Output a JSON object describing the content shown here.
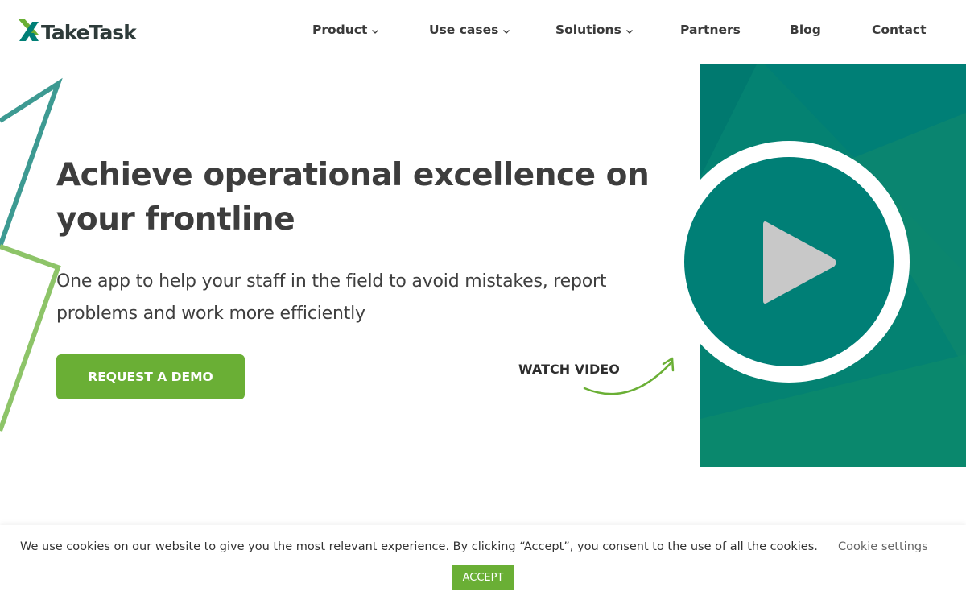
{
  "brand": {
    "name": "TakeTask",
    "logo_icon": "taketask-x-logo-icon",
    "colors": {
      "teal": "#007f76",
      "green": "#6aaf35",
      "dark_text": "#3d3d3d"
    }
  },
  "nav": {
    "items": [
      {
        "label": "Product",
        "has_dropdown": true
      },
      {
        "label": "Use cases",
        "has_dropdown": true
      },
      {
        "label": "Solutions",
        "has_dropdown": true
      },
      {
        "label": "Partners",
        "has_dropdown": false
      },
      {
        "label": "Blog",
        "has_dropdown": false
      },
      {
        "label": "Contact",
        "has_dropdown": false
      }
    ],
    "dropdown_icon": "chevron-down-icon"
  },
  "hero": {
    "title": "Achieve operational excellence on your frontline",
    "subtitle": "One app to help your staff in the field to avoid mistakes, report problems and work more efficiently",
    "cta_label": "REQUEST A DEMO",
    "watch_label": "WATCH VIDEO",
    "play_icon": "play-icon",
    "arrow_icon": "curved-arrow-icon"
  },
  "cookie_bar": {
    "message": "We use cookies on our website to give you the most relevant experience. By clicking “Accept”, you consent to the use of all the cookies.",
    "settings_label": "Cookie settings",
    "accept_label": "ACCEPT"
  }
}
